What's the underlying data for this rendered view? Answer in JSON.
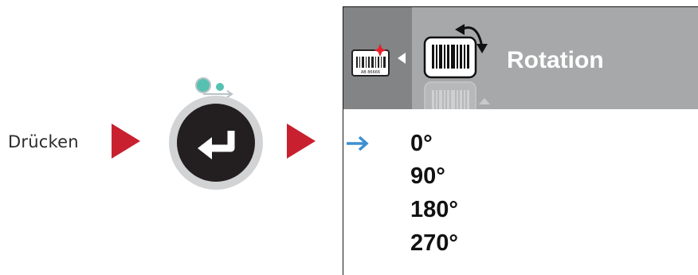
{
  "instruction": {
    "label": "Drücken"
  },
  "enter_button": {
    "icon": "enter-return-icon",
    "indicator_icon": "led-indicator-icon"
  },
  "screen": {
    "title": "Rotation",
    "icons": {
      "menu_icon": "label-barcode-icon",
      "setting_icon": "barcode-rotation-icon"
    },
    "options": [
      {
        "label": "0°",
        "selected": true
      },
      {
        "label": "90°",
        "selected": false
      },
      {
        "label": "180°",
        "selected": false
      },
      {
        "label": "270°",
        "selected": false
      }
    ],
    "barcode_caption": "AB 86666"
  },
  "colors": {
    "accent_red": "#c8202f",
    "selection_blue": "#3d8fd1",
    "teal": "#56c1b0",
    "header_dark": "#838485",
    "header_light": "#a7a8aa"
  }
}
